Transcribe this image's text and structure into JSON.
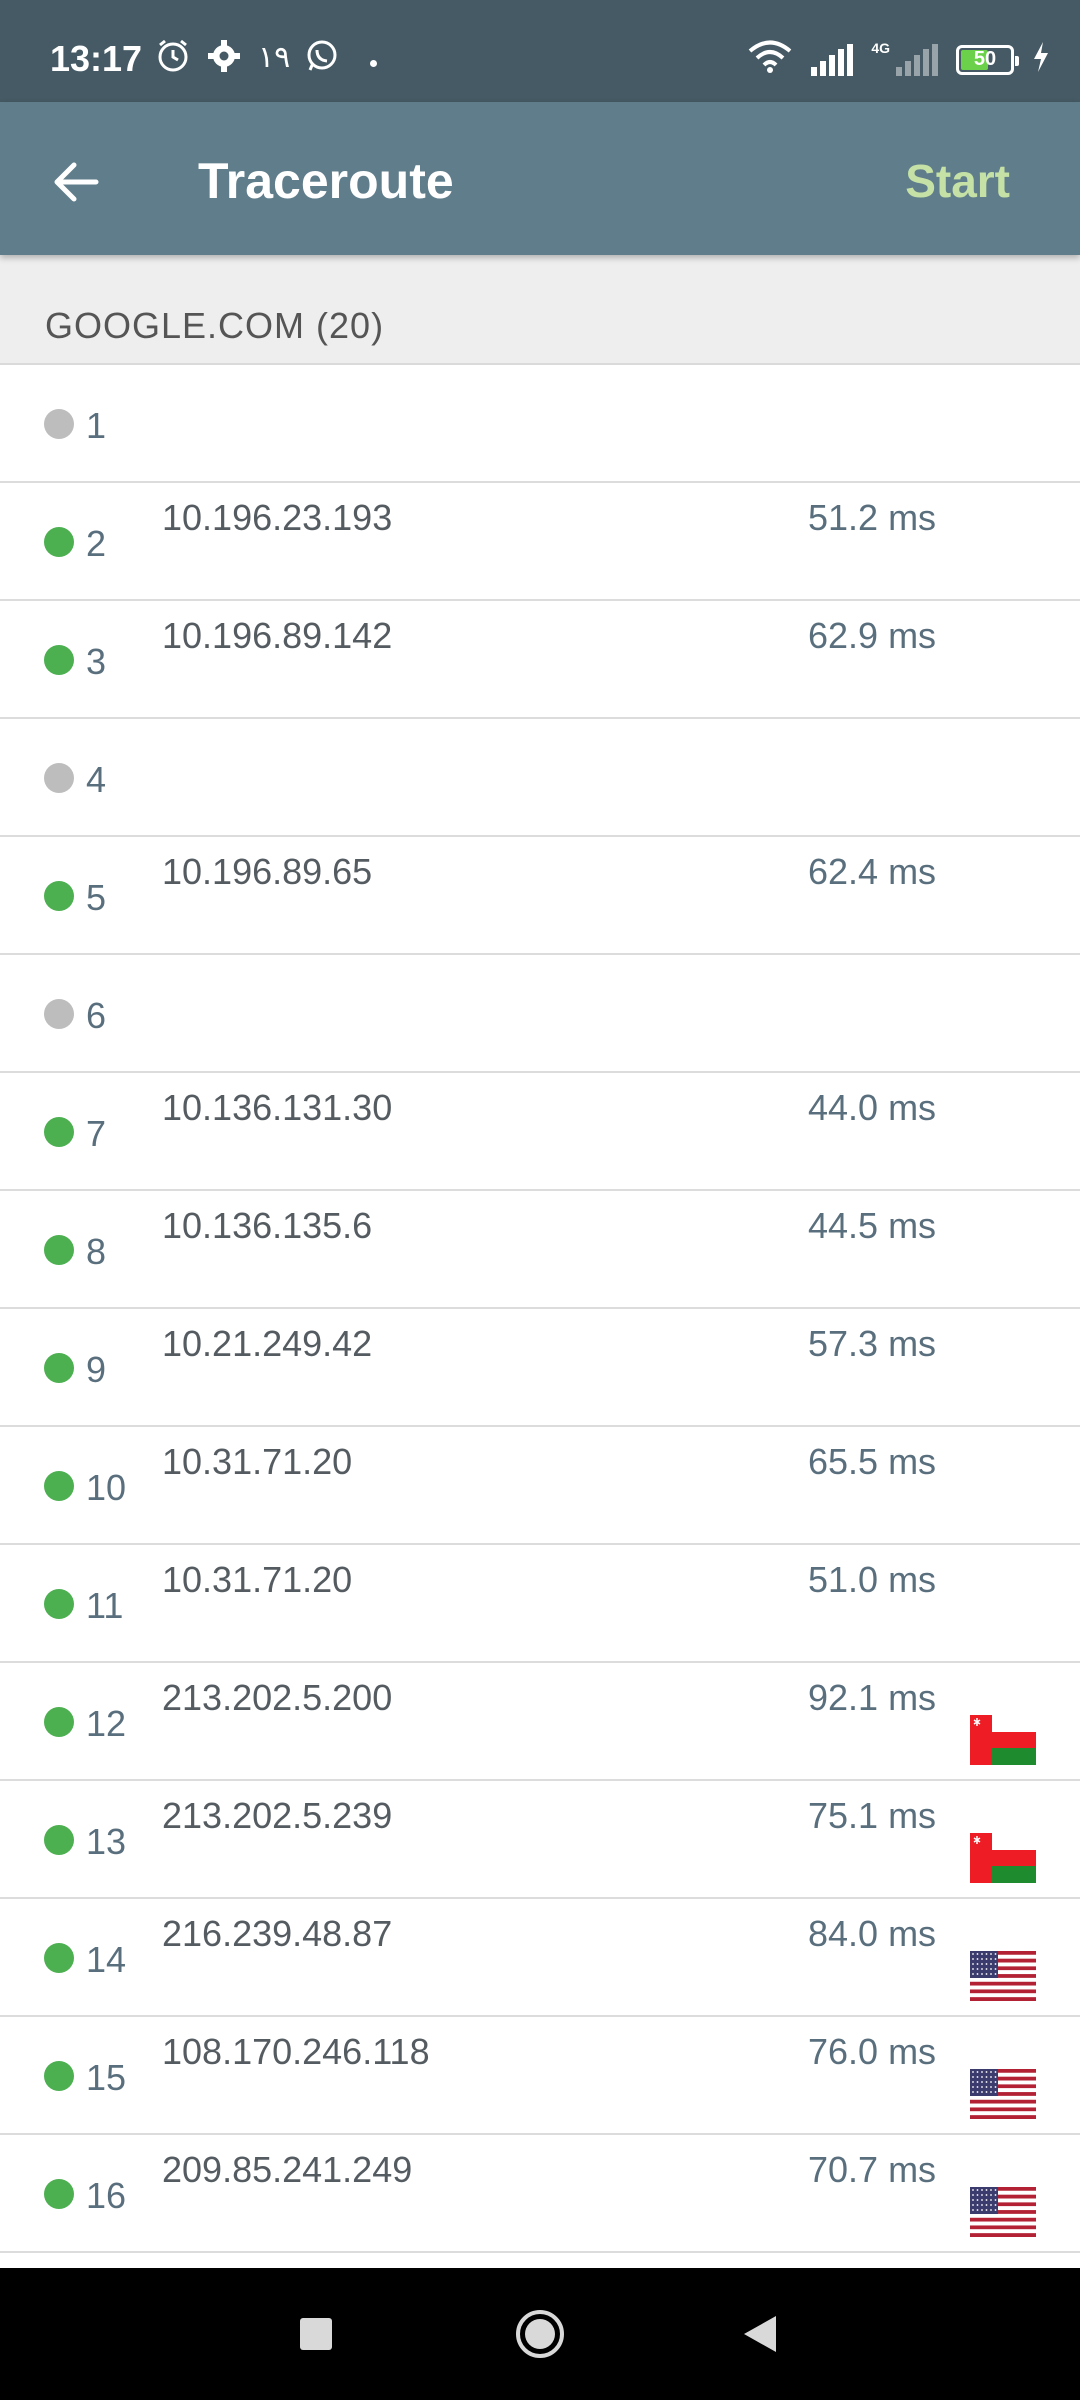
{
  "status_bar": {
    "time": "13:17",
    "arabic_text": "١٩",
    "battery": "50",
    "network_type": "4G",
    "icons": [
      "alarm-icon",
      "gear-icon",
      "whatsapp-icon",
      "wifi-icon",
      "signal-icon",
      "battery-icon",
      "charging-icon"
    ]
  },
  "app_bar": {
    "title": "Traceroute",
    "action": "Start",
    "back_icon": "arrow-left-icon",
    "accent": "#c5e1a5",
    "bg": "#607d8b"
  },
  "section": {
    "header": "GOOGLE.COM (20)"
  },
  "hops": [
    {
      "num": "1",
      "ip": "",
      "time": "",
      "status": "none",
      "flag": ""
    },
    {
      "num": "2",
      "ip": "10.196.23.193",
      "time": "51.2 ms",
      "status": "ok",
      "flag": ""
    },
    {
      "num": "3",
      "ip": "10.196.89.142",
      "time": "62.9 ms",
      "status": "ok",
      "flag": ""
    },
    {
      "num": "4",
      "ip": "",
      "time": "",
      "status": "none",
      "flag": ""
    },
    {
      "num": "5",
      "ip": "10.196.89.65",
      "time": "62.4 ms",
      "status": "ok",
      "flag": ""
    },
    {
      "num": "6",
      "ip": "",
      "time": "",
      "status": "none",
      "flag": ""
    },
    {
      "num": "7",
      "ip": "10.136.131.30",
      "time": "44.0 ms",
      "status": "ok",
      "flag": ""
    },
    {
      "num": "8",
      "ip": "10.136.135.6",
      "time": "44.5 ms",
      "status": "ok",
      "flag": ""
    },
    {
      "num": "9",
      "ip": "10.21.249.42",
      "time": "57.3 ms",
      "status": "ok",
      "flag": ""
    },
    {
      "num": "10",
      "ip": "10.31.71.20",
      "time": "65.5 ms",
      "status": "ok",
      "flag": ""
    },
    {
      "num": "11",
      "ip": "10.31.71.20",
      "time": "51.0 ms",
      "status": "ok",
      "flag": ""
    },
    {
      "num": "12",
      "ip": "213.202.5.200",
      "time": "92.1 ms",
      "status": "ok",
      "flag": "oman"
    },
    {
      "num": "13",
      "ip": "213.202.5.239",
      "time": "75.1 ms",
      "status": "ok",
      "flag": "oman"
    },
    {
      "num": "14",
      "ip": "216.239.48.87",
      "time": "84.0 ms",
      "status": "ok",
      "flag": "usa"
    },
    {
      "num": "15",
      "ip": "108.170.246.118",
      "time": "76.0 ms",
      "status": "ok",
      "flag": "usa"
    },
    {
      "num": "16",
      "ip": "209.85.241.249",
      "time": "70.7 ms",
      "status": "ok",
      "flag": "usa"
    }
  ],
  "nav_bar": {
    "icons": [
      "recents-square-icon",
      "home-circle-icon",
      "back-triangle-icon"
    ]
  }
}
